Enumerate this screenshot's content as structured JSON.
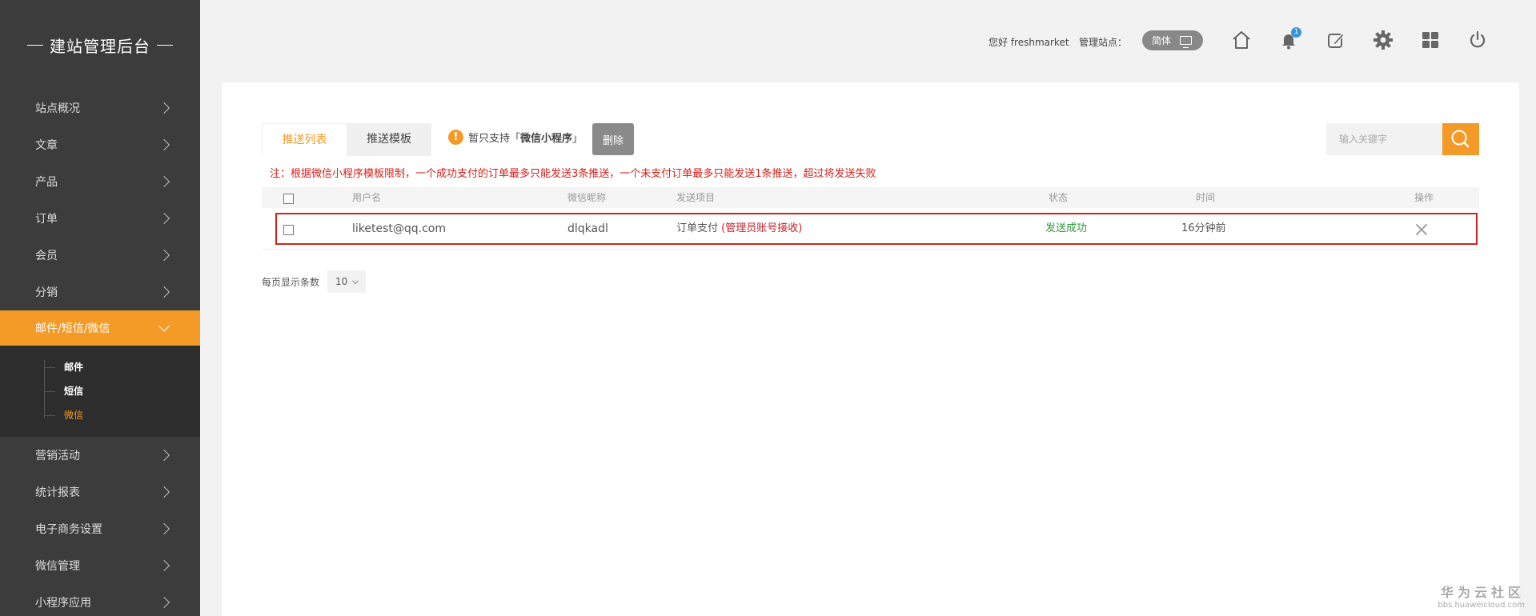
{
  "sidebar": {
    "brand": "建站管理后台",
    "items": [
      {
        "label": "站点概况"
      },
      {
        "label": "文章"
      },
      {
        "label": "产品"
      },
      {
        "label": "订单"
      },
      {
        "label": "会员"
      },
      {
        "label": "分销"
      },
      {
        "label": "邮件/短信/微信"
      },
      {
        "label": "营销活动"
      },
      {
        "label": "统计报表"
      },
      {
        "label": "电子商务设置"
      },
      {
        "label": "微信管理"
      },
      {
        "label": "小程序应用"
      }
    ],
    "subitems": [
      {
        "label": "邮件"
      },
      {
        "label": "短信"
      },
      {
        "label": "微信"
      }
    ]
  },
  "header": {
    "greeting": "您好 freshmarket",
    "site_label": "管理站点：",
    "lang": "简体",
    "notification_count": "1",
    "icons": [
      "home-icon",
      "bell-icon",
      "edit-icon",
      "gear-icon",
      "grid-icon",
      "power-icon"
    ]
  },
  "main": {
    "tabs": [
      {
        "label": "推送列表"
      },
      {
        "label": "推送模板"
      }
    ],
    "notice_prefix": "暂只支持「",
    "notice_strong": "微信小程序",
    "notice_suffix": "」",
    "delete_label": "删除",
    "search_placeholder": "输入关键字",
    "note": "注：根据微信小程序模板限制，一个成功支付的订单最多只能发送3条推送，一个未支付订单最多只能发送1条推送，超过将发送失败",
    "columns": {
      "username": "用户名",
      "nickname": "微信昵称",
      "item": "发送项目",
      "status": "状态",
      "time": "时间",
      "action": "操作"
    },
    "rows": [
      {
        "username": "liketest@qq.com",
        "nickname": "dlqkadl",
        "item": "订单支付",
        "item_note": "(管理员账号接收)",
        "status": "发送成功",
        "time": "16分钟前"
      }
    ],
    "page_size_label": "每页显示条数",
    "page_size": "10"
  },
  "watermark": {
    "title": "华为云社区",
    "url": "bbs.huaweicloud.com"
  },
  "colors": {
    "accent": "#f39a27",
    "sidebar_bg": "#3c3c3c",
    "danger": "#d0221b",
    "success": "#2e9a3a"
  }
}
